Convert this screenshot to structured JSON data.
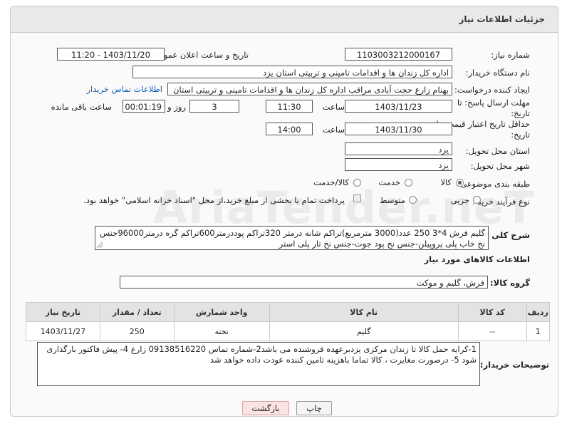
{
  "header": {
    "title": "جزئیات اطلاعات نیاز"
  },
  "form": {
    "need_number_label": "شماره نیاز:",
    "need_number": "1103003212000167",
    "announce_label": "تاریخ و ساعت اعلان عمومی:",
    "announce_value": "1403/11/20 - 11:20",
    "buyer_label": "نام دستگاه خریدار:",
    "buyer_value": "اداره کل زندان ها و اقدامات تامینی و تربیتی استان یزد",
    "creator_label": "ایجاد کننده درخواست:",
    "creator_value": "بهنام زارع حجت آبادی مراقب اداره کل زندان ها و اقدامات تامینی و تربیتی استان",
    "contact_link": "اطلاعات تماس خریدار",
    "deadline_label": "مهلت ارسال پاسخ: تا تاریخ:",
    "deadline_date": "1403/11/23",
    "hour_label": "ساعت",
    "deadline_time": "11:30",
    "day_label": "روز و",
    "days_value": "3",
    "remaining_time": "00:01:19",
    "remaining_label": "ساعت باقی مانده",
    "validity_label": "حداقل تاریخ اعتبار قیمت: تا تاریخ:",
    "validity_date": "1403/11/30",
    "validity_hour_label": "ساعت",
    "validity_time": "14:00",
    "province_label": "استان محل تحویل:",
    "province_value": "یزد",
    "city_label": "شهر محل تحویل:",
    "city_value": "یزد",
    "category_label": "طبقه بندی موضوعی:",
    "category_options": [
      "کالا",
      "خدمت",
      "کالا/خدمت"
    ],
    "category_selected": "کالا",
    "process_label": "نوع فرآیند خرید :",
    "process_options": [
      "جزیی",
      "متوسط"
    ],
    "process_selected": "جزیی",
    "payment_note": "پرداخت تمام یا بخشی از مبلغ خرید،از محل \"اسناد خزانه اسلامی\" خواهد بود."
  },
  "description": {
    "label": "شرح کلی نیاز:",
    "text": "گلیم فرش 4*3 250 عدد(3000 مترمربع)تراکم شانه درمتر 320تراکم پوددرمتر600تراکم گره درمتر96000جنس نخ خاب پلی پروپیلن-جنس نخ پود جوت-جنس نخ تار پلی استر"
  },
  "goods": {
    "section_title": "اطلاعات کالاهای مورد نیاز",
    "group_label": "گروه کالا:",
    "group_value": "فرش، گلیم و موکت",
    "columns": [
      "ردیف",
      "کد کالا",
      "نام کالا",
      "واحد شمارش",
      "تعداد / مقدار",
      "تاریخ نیاز"
    ],
    "rows": [
      [
        "1",
        "--",
        "گلیم",
        "تخته",
        "250",
        "1403/11/27"
      ]
    ]
  },
  "buyer_notes": {
    "label": "توضیحات خریدار:",
    "text": "1-کرایه حمل کالا تا زندان مرکزی یزدبرعهده فروشنده می باشد2-شماره تماس 09138516220 زارع  4- پیش فاکتور بارگذاری شود 5- درصورت مغایرت ، کالا تماما باهزینه تامین کننده عودت داده خواهد شد"
  },
  "buttons": {
    "print": "چاپ",
    "back": "بازگشت"
  },
  "watermark": "AriaTender.neT"
}
